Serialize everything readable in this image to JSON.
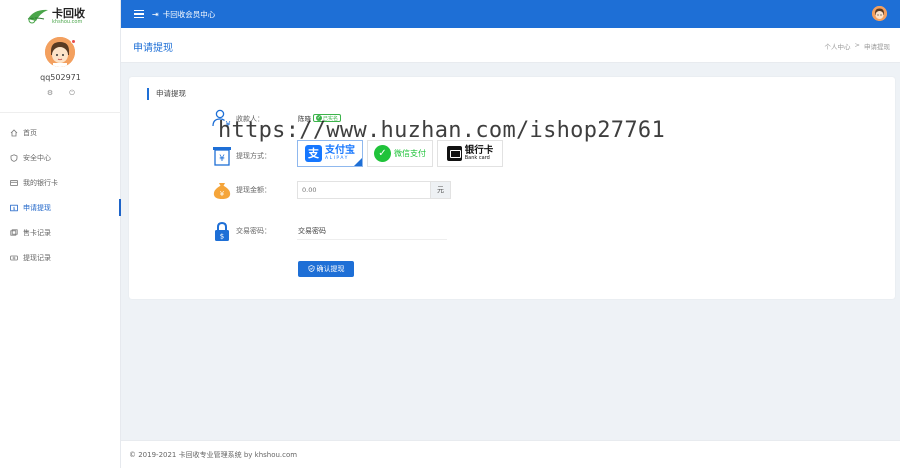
{
  "brand": {
    "name": "卡回收",
    "domain": "khshou.com"
  },
  "user": {
    "username": "qq502971"
  },
  "sidebar": {
    "items": [
      {
        "label": "首页",
        "icon": "home-icon",
        "active": false
      },
      {
        "label": "安全中心",
        "icon": "shield-icon",
        "active": false
      },
      {
        "label": "我的银行卡",
        "icon": "card-icon",
        "active": false
      },
      {
        "label": "申请提现",
        "icon": "withdraw-icon",
        "active": true
      },
      {
        "label": "售卡记录",
        "icon": "record-icon",
        "active": false
      },
      {
        "label": "提现记录",
        "icon": "money-record-icon",
        "active": false
      }
    ]
  },
  "topbar": {
    "title": "卡回收会员中心"
  },
  "page": {
    "title": "申请提现",
    "breadcrumb": [
      "个人中心",
      ">",
      "申请提现"
    ]
  },
  "form": {
    "section_title": "申请提现",
    "recipient_label": "收款人：",
    "recipient_value": "陈晓",
    "verified_label": "已实名",
    "method_label": "提现方式：",
    "methods": [
      {
        "cn": "支付宝",
        "en": "ALIPAY",
        "selected": true
      },
      {
        "cn": "微信支付",
        "selected": false
      },
      {
        "cn": "银行卡",
        "en": "Bank card",
        "selected": false
      }
    ],
    "amount_label": "提现金额：",
    "amount_placeholder": "0.00",
    "amount_unit": "元",
    "password_label": "交易密码：",
    "password_value": "交易密码",
    "submit_label": "确认提现"
  },
  "watermark": "https://www.huzhan.com/ishop27761",
  "footer": {
    "text": "© 2019-2021 卡回收专业管理系统 by khshou.com"
  },
  "colors": {
    "primary": "#1e6fd6",
    "alipay": "#1677ff",
    "wechat": "#20c33a",
    "accent_orange": "#f5a53a"
  }
}
